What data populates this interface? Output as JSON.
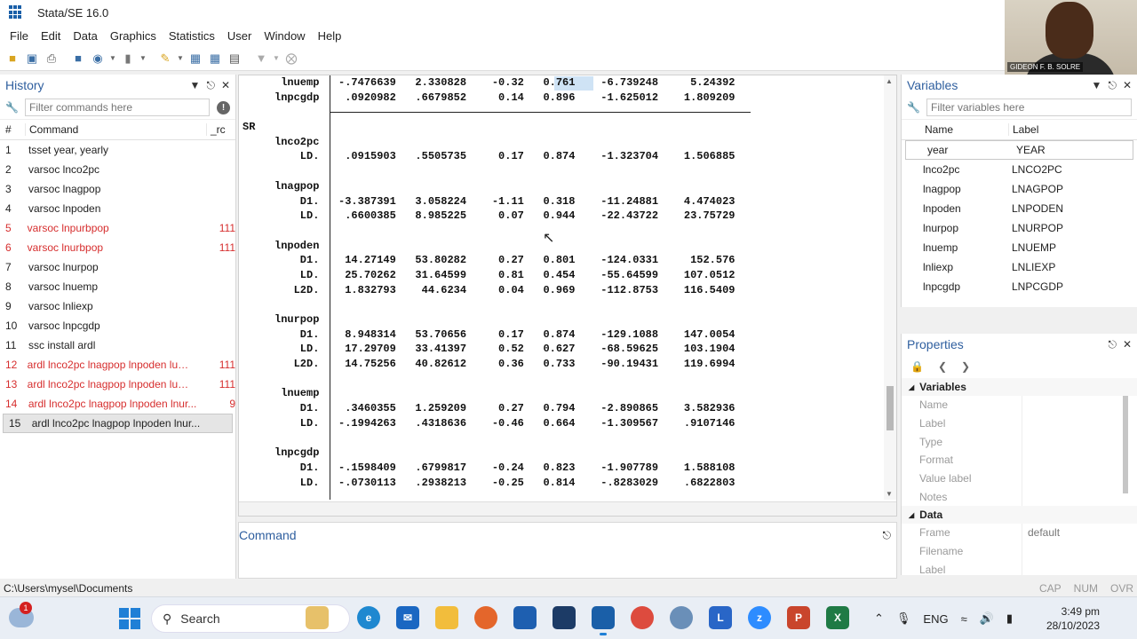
{
  "window": {
    "title": "Stata/SE 16.0"
  },
  "menu": [
    "File",
    "Edit",
    "Data",
    "Graphics",
    "Statistics",
    "User",
    "Window",
    "Help"
  ],
  "webcam": {
    "label": "GIDEON F. B. SOLRE"
  },
  "history": {
    "title": "History",
    "filter_placeholder": "Filter commands here",
    "col_num": "#",
    "col_command": "Command",
    "col_rc": "_rc",
    "rows": [
      {
        "n": "1",
        "cmd": "tsset year, yearly",
        "rc": ""
      },
      {
        "n": "2",
        "cmd": "varsoc lnco2pc",
        "rc": ""
      },
      {
        "n": "3",
        "cmd": "varsoc lnagpop",
        "rc": ""
      },
      {
        "n": "4",
        "cmd": "varsoc lnpoden",
        "rc": ""
      },
      {
        "n": "5",
        "cmd": "varsoc lnpurbpop",
        "rc": "111"
      },
      {
        "n": "6",
        "cmd": "varsoc lnurbpop",
        "rc": "111"
      },
      {
        "n": "7",
        "cmd": "varsoc lnurpop",
        "rc": ""
      },
      {
        "n": "8",
        "cmd": "varsoc lnuemp",
        "rc": ""
      },
      {
        "n": "9",
        "cmd": "varsoc lnliexp",
        "rc": ""
      },
      {
        "n": "10",
        "cmd": "varsoc lnpcgdp",
        "rc": ""
      },
      {
        "n": "11",
        "cmd": "ssc install ardl",
        "rc": ""
      },
      {
        "n": "12",
        "cmd": "ardl lnco2pc lnagpop lnpoden lurp...",
        "rc": "111"
      },
      {
        "n": "13",
        "cmd": "ardl lnco2pc lnagpop lnpoden lurp...",
        "rc": "111"
      },
      {
        "n": "14",
        "cmd": "ardl lnco2pc lnagpop lnpoden lnur...",
        "rc": "9"
      },
      {
        "n": "15",
        "cmd": "ardl lnco2pc lnagpop lnpoden lnur...",
        "rc": ""
      }
    ]
  },
  "results": {
    "lines": [
      "      lnuemp   -.7476639   2.330828    -0.32   0.761    -6.739248     5.24392",
      "     lnpcgdp    .0920982   .6679852     0.14   0.896    -1.625012    1.809209",
      "",
      "SR",
      "     lnco2pc",
      "         LD.    .0915903   .5505735     0.17   0.874    -1.323704    1.506885",
      "",
      "     lnagpop",
      "         D1.   -3.387391   3.058224    -1.11   0.318    -11.24881    4.474023",
      "         LD.    .6600385   8.985225     0.07   0.944    -22.43722    23.75729",
      "",
      "     lnpoden",
      "         D1.    14.27149   53.80282     0.27   0.801    -124.0331     152.576",
      "         LD.    25.70262   31.64599     0.81   0.454    -55.64599    107.0512",
      "        L2D.    1.832793    44.6234     0.04   0.969    -112.8753    116.5409",
      "",
      "     lnurpop",
      "         D1.    8.948314   53.70656     0.17   0.874    -129.1088    147.0054",
      "         LD.    17.29709   33.41397     0.52   0.627    -68.59625    103.1904",
      "        L2D.    14.75256   40.82612     0.36   0.733    -90.19431    119.6994",
      "",
      "      lnuemp",
      "         D1.    .3460355   1.259209     0.27   0.794    -2.890865    3.582936",
      "         LD.   -.1994263   .4318636    -0.46   0.664    -1.309567    .9107146",
      "",
      "     lnpcgdp",
      "         D1.   -.1598409   .6799817    -0.24   0.823    -1.907789    1.588108",
      "         LD.   -.0730113   .2938213    -0.25   0.814    -.8283029    .6822803"
    ]
  },
  "command": {
    "title": "Command"
  },
  "variables": {
    "title": "Variables",
    "filter_placeholder": "Filter variables here",
    "col_name": "Name",
    "col_label": "Label",
    "rows": [
      {
        "name": "year",
        "label": "YEAR"
      },
      {
        "name": "lnco2pc",
        "label": "LNCO2PC"
      },
      {
        "name": "lnagpop",
        "label": "LNAGPOP"
      },
      {
        "name": "lnpoden",
        "label": "LNPODEN"
      },
      {
        "name": "lnurpop",
        "label": "LNURPOP"
      },
      {
        "name": "lnuemp",
        "label": "LNUEMP"
      },
      {
        "name": "lnliexp",
        "label": "LNLIEXP"
      },
      {
        "name": "lnpcgdp",
        "label": "LNPCGDP"
      }
    ]
  },
  "properties": {
    "title": "Properties",
    "group_variables": "Variables",
    "var_fields": [
      "Name",
      "Label",
      "Type",
      "Format",
      "Value label",
      "Notes"
    ],
    "group_data": "Data",
    "data_fields": [
      {
        "k": "Frame",
        "v": "default"
      },
      {
        "k": "Filename",
        "v": ""
      },
      {
        "k": "Label",
        "v": ""
      }
    ]
  },
  "status": {
    "path": "C:\\Users\\mysel\\Documents",
    "cap": "CAP",
    "num": "NUM",
    "ovr": "OVR"
  },
  "taskbar": {
    "search": "Search",
    "weather_badge": "1",
    "lang": "ENG",
    "time": "3:49 pm",
    "date": "28/10/2023"
  },
  "colors": {
    "accent": "#2f5f9f",
    "error": "#d62e2e"
  }
}
